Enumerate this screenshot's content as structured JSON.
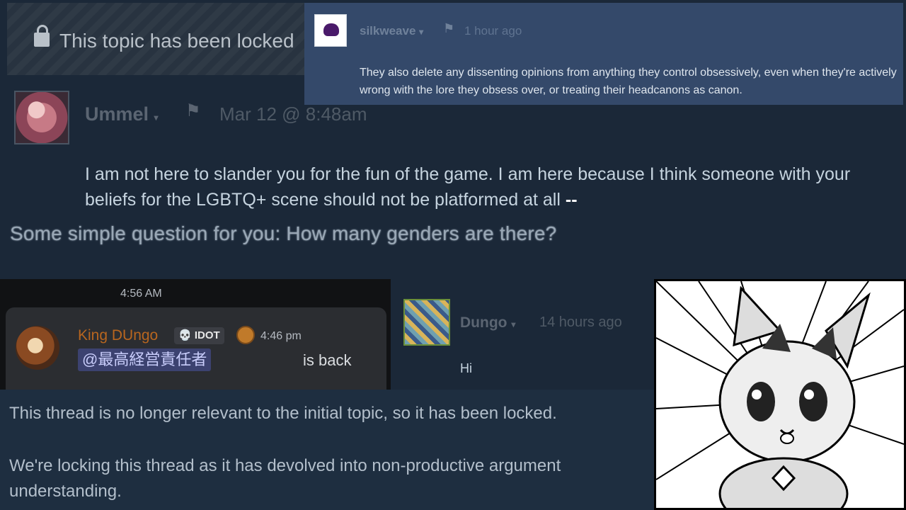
{
  "locked_banner": {
    "text": "This topic has been locked",
    "icon": "lock-icon"
  },
  "ummel_post": {
    "author": "Ummel",
    "caret": "▾",
    "award_icon": "award-icon",
    "timestamp": "Mar 12 @ 8:48am",
    "body": "I am not here to slander you for the fun of the game. I am here because I think someone with your beliefs for the LGBTQ+ scene should not be platformed at all",
    "body_dash": "--",
    "question": "Some simple question for you: How many genders are there?"
  },
  "silkweave_post": {
    "author": "silkweave",
    "caret": "▾",
    "timestamp": "1 hour ago",
    "body": "They also delete any dissenting opinions from anything they control obsessively, even when they're actively wrong with the lore they obsess over, or treating their headcanons as canon."
  },
  "discord": {
    "top_time": "4:56 AM",
    "author": "King DUngo",
    "badge": "💀 IDOT",
    "time": "4:46 pm",
    "mention": "@最高経営責任者",
    "message": "is back"
  },
  "dungo_post": {
    "author": "Dungo",
    "caret": "▾",
    "timestamp": "14 hours ago",
    "body": "Hi"
  },
  "moderator": {
    "msg1": "This thread is no longer relevant to the initial topic, so it has been locked.",
    "msg2": "We're locking this thread as it has devolved into non-productive argument",
    "msg2b": "understanding."
  },
  "colors": {
    "background": "#1b2838",
    "overlay": "#34496a",
    "discord_bg": "#2b2d31",
    "mention": "#3c4270"
  }
}
